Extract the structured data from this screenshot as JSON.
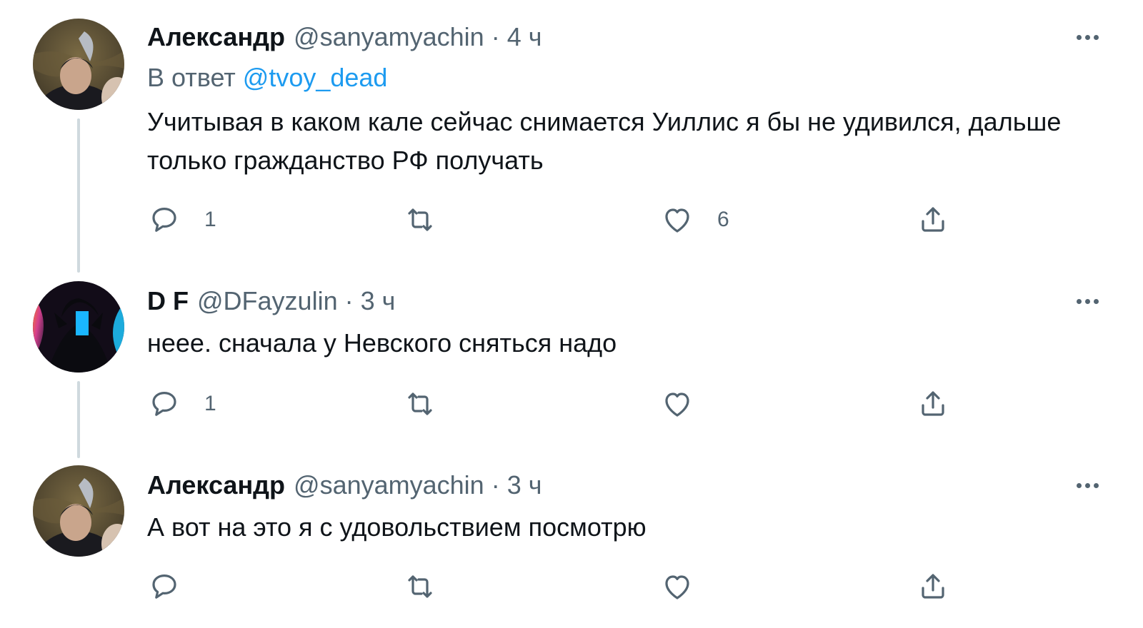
{
  "tweets": [
    {
      "display_name": "Александр",
      "handle": "@sanyamyachin",
      "separator": "·",
      "time": "4 ч",
      "reply_prefix": "В ответ",
      "reply_mention": "@tvoy_dead",
      "text": "Учитывая в каком кале сейчас снимается Уиллис я бы не удивился, дальше только гражданство РФ получать",
      "reply_count": "1",
      "retweet_count": "",
      "like_count": "6",
      "avatar": "avatar-photo-alexandr"
    },
    {
      "display_name": "D F",
      "handle": "@DFayzulin",
      "separator": "·",
      "time": "3 ч",
      "text": "неее. сначала у Невского сняться надо",
      "reply_count": "1",
      "retweet_count": "",
      "like_count": "",
      "avatar": "avatar-art-df"
    },
    {
      "display_name": "Александр",
      "handle": "@sanyamyachin",
      "separator": "·",
      "time": "3 ч",
      "text": "А вот на это я с удовольствием посмотрю",
      "reply_count": "",
      "retweet_count": "",
      "like_count": "",
      "avatar": "avatar-photo-alexandr"
    }
  ],
  "icons": {
    "reply": "reply-icon",
    "retweet": "retweet-icon",
    "like": "heart-icon",
    "share": "share-icon",
    "more": "more-icon"
  },
  "colors": {
    "text": "#0f1419",
    "secondary": "#536471",
    "link": "#1d9bf0",
    "thread_line": "#cfd9de"
  }
}
